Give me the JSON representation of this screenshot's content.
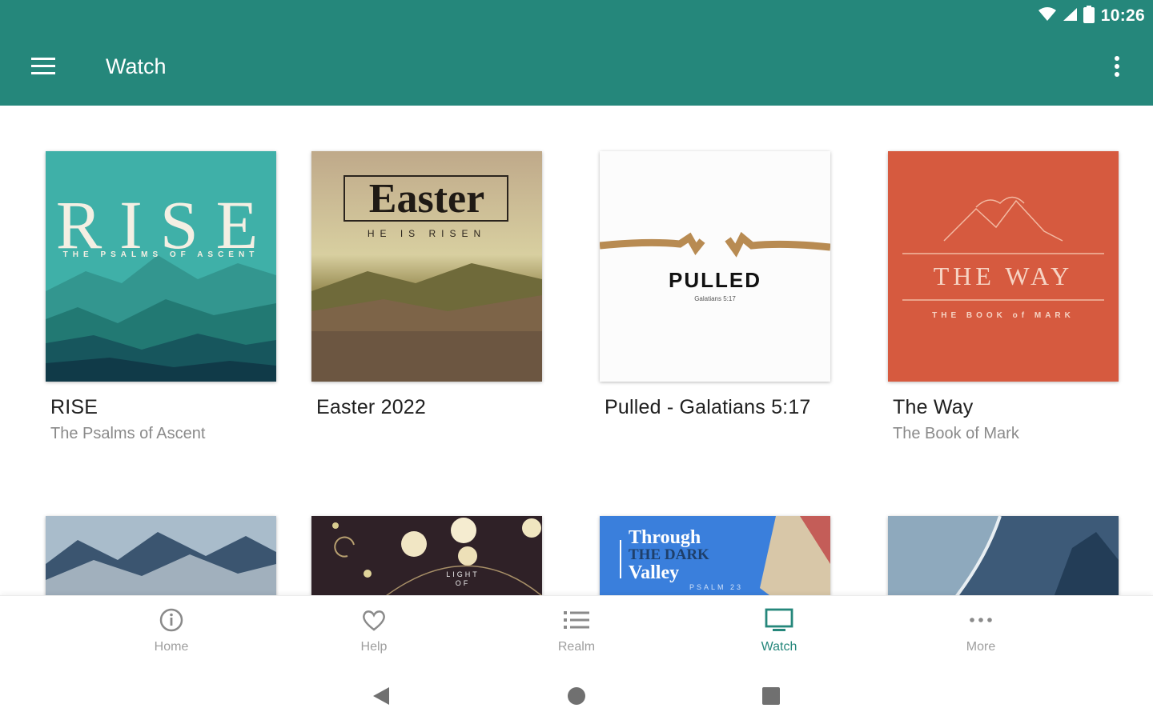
{
  "status_bar": {
    "time": "10:26",
    "icons": [
      "wifi-icon",
      "signal-icon",
      "battery-icon"
    ]
  },
  "app_bar": {
    "title": "Watch",
    "menu_icon": "hamburger-menu-icon",
    "overflow_icon": "more-vert-icon",
    "color": "#25877b"
  },
  "series": [
    {
      "title": "RISE",
      "subtitle": "The Psalms of Ascent",
      "art": {
        "big": "RISE",
        "small": "THE PSALMS OF ASCENT"
      }
    },
    {
      "title": "Easter 2022",
      "subtitle": "",
      "art": {
        "big": "Easter",
        "small": "HE IS RISEN"
      }
    },
    {
      "title": "Pulled - Galatians 5:17",
      "subtitle": "",
      "art": {
        "big": "PULLED",
        "small": "Galatians 5:17"
      }
    },
    {
      "title": "The Way",
      "subtitle": "The Book of Mark",
      "art": {
        "big": "THE WAY",
        "small": "THE BOOK of MARK"
      }
    }
  ],
  "partial_row_art": [
    {
      "text": []
    },
    {
      "text": [
        "LIGHT",
        "OF"
      ]
    },
    {
      "text": [
        "Through",
        "THE DARK",
        "Valley",
        "PSALM 23"
      ]
    },
    {
      "text": []
    }
  ],
  "bottom_nav": [
    {
      "label": "Home",
      "icon": "info-circle-icon",
      "active": false
    },
    {
      "label": "Help",
      "icon": "heart-icon",
      "active": false
    },
    {
      "label": "Realm",
      "icon": "list-icon",
      "active": false
    },
    {
      "label": "Watch",
      "icon": "tv-icon",
      "active": true
    },
    {
      "label": "More",
      "icon": "more-horiz-icon",
      "active": false
    }
  ],
  "system_nav": {
    "back": "back-triangle-icon",
    "home": "home-circle-icon",
    "recents": "recents-square-icon"
  }
}
